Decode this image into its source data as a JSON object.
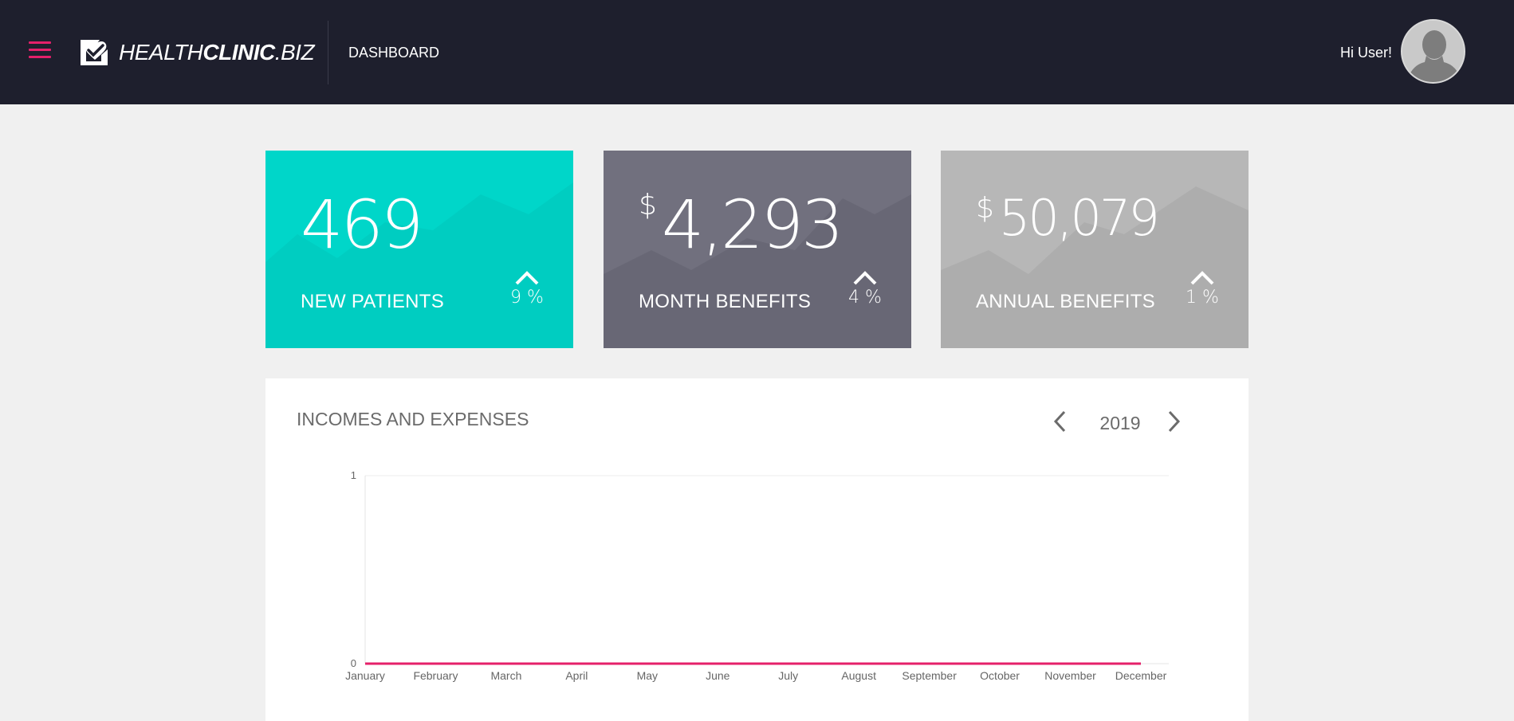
{
  "header": {
    "brand_light": "HEALTH",
    "brand_bold": "CLINIC",
    "brand_tld": ".BIZ",
    "nav_title": "DASHBOARD",
    "greeting": "Hi User!",
    "menu_icon": "hamburger-menu-icon",
    "accent_color": "#e5206a",
    "background_color": "#1e1f2d"
  },
  "stats": [
    {
      "value": "469",
      "currency": "",
      "label": "NEW PATIENTS",
      "trend_pct": "9 %",
      "trend_icon": "chevron-up-icon",
      "color": "#00d6c9"
    },
    {
      "value": "4,293",
      "currency": "$",
      "label": "MONTH BENEFITS",
      "trend_pct": "4 %",
      "trend_icon": "chevron-up-icon",
      "color": "#71707e"
    },
    {
      "value": "50,079",
      "currency": "$",
      "label": "ANNUAL BENEFITS",
      "trend_pct": "1 %",
      "trend_icon": "chevron-up-icon",
      "color": "#b7b7b7"
    }
  ],
  "panel": {
    "title": "INCOMES AND EXPENSES",
    "year": "2019",
    "prev_icon": "chevron-left-icon",
    "next_icon": "chevron-right-icon"
  },
  "chart_data": {
    "type": "line",
    "title": "",
    "xlabel": "",
    "ylabel": "",
    "categories": [
      "January",
      "February",
      "March",
      "April",
      "May",
      "June",
      "July",
      "August",
      "September",
      "October",
      "November",
      "December"
    ],
    "ylim": [
      0,
      1
    ],
    "yticks": [
      "0",
      "1"
    ],
    "grid": true,
    "series": [
      {
        "values": [
          0,
          0,
          0,
          0,
          0,
          0,
          0,
          0,
          0,
          0,
          0,
          0
        ],
        "color": "#e5206a"
      }
    ]
  }
}
